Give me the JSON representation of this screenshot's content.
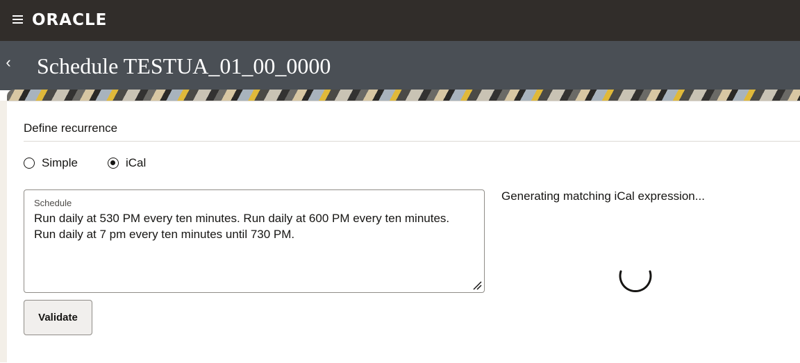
{
  "topbar": {
    "brand": "ORACLE",
    "menu_icon": "hamburger-menu-icon",
    "background": "#312d2a"
  },
  "header": {
    "back_icon": "chevron-left-icon",
    "back_glyph": "‹",
    "title": "Schedule TESTUA_01_00_0000",
    "background": "#4a4f55"
  },
  "recurrence": {
    "section_title": "Define recurrence",
    "options": [
      {
        "label": "Simple",
        "selected": false
      },
      {
        "label": "iCal",
        "selected": true
      }
    ]
  },
  "schedule_field": {
    "label": "Schedule",
    "value": "Run daily at 530 PM every ten minutes. Run daily at 600 PM every ten minutes. Run daily at 7 pm every ten minutes until 730 PM."
  },
  "actions": {
    "validate_label": "Validate"
  },
  "status": {
    "message": "Generating matching iCal expression...",
    "spinner_icon": "loading-spinner-icon"
  }
}
